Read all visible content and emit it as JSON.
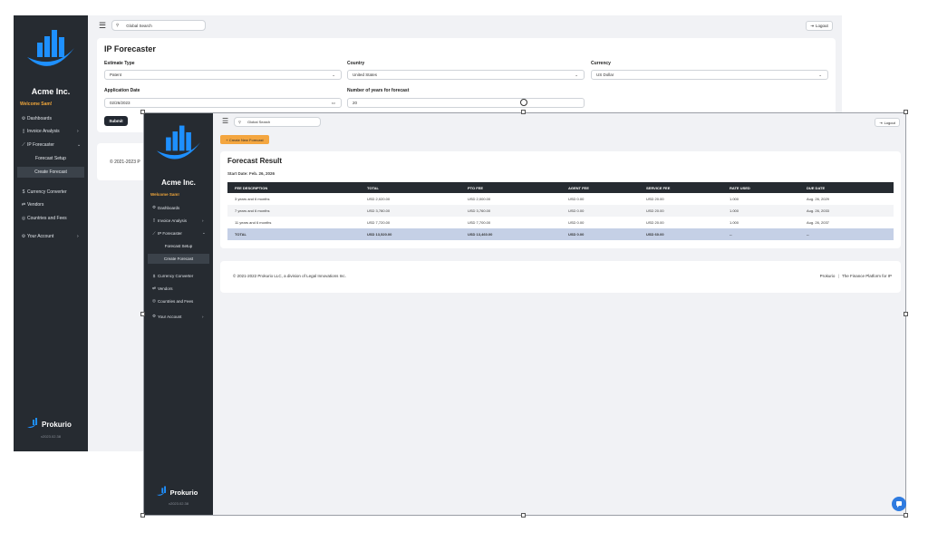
{
  "colors": {
    "sidebar": "#262b31",
    "accent_orange": "#f4a640",
    "welcome": "#f0a63a",
    "total_row": "#c5d0e6",
    "chat": "#2e7be0"
  },
  "back": {
    "search_placeholder": "Global Search",
    "logout_label": "Logout",
    "sidebar": {
      "company": "Acme Inc.",
      "welcome": "Welcome Sam!",
      "items": {
        "dashboards": "Dashboards",
        "invoice": "Invoice Analysis",
        "forecaster": "IP Forecaster",
        "forecast_setup": "Forecast Setup",
        "create_forecast": "Create Forecast",
        "currency": "Currency Converter",
        "vendors": "Vendors",
        "countries": "Countries and Fees",
        "account": "Your Account"
      },
      "footer_brand": "Prokurio",
      "version": "v2023.02.38"
    },
    "form": {
      "title": "IP Forecaster",
      "estimate_type_label": "Estimate Type",
      "estimate_type_value": "Patent",
      "country_label": "Country",
      "country_value": "United States",
      "currency_label": "Currency",
      "currency_value": "US Dollar",
      "application_date_label": "Application Date",
      "application_date_value": "02/26/2023",
      "years_label": "Number of years for forecast",
      "years_value": "20",
      "submit_label": "Submit"
    },
    "footer_partial": "© 2021-2023 P"
  },
  "front": {
    "search_placeholder": "Global Search",
    "logout_label": "Logout",
    "create_new_label": "+ Create New Forecast",
    "sidebar": {
      "company": "Acme Inc.",
      "welcome": "Welcome Sam!",
      "items": {
        "dashboards": "Dashboards",
        "invoice": "Invoice Analysis",
        "forecaster": "IP Forecaster",
        "forecast_setup": "Forecast Setup",
        "create_forecast": "Create Forecast",
        "currency": "Currency Converter",
        "vendors": "Vendors",
        "countries": "Countries and Fees",
        "account": "Your Account"
      },
      "footer_brand": "Prokurio",
      "version": "v2023.02.38"
    },
    "result": {
      "title": "Forecast Result",
      "start_date": "Start Date: Feb. 26, 2026",
      "headers": [
        "FEE DESCRIPTION",
        "TOTAL",
        "PTO FEE",
        "AGENT FEE",
        "SERVICE FEE",
        "RATE USED",
        "DUE DATE"
      ],
      "rows": [
        [
          "3 years and 6 months",
          "USD 2,020.00",
          "USD 2,000.00",
          "USD 0.00",
          "USD 20.00",
          "1.000",
          "Aug. 26, 2029"
        ],
        [
          "7 years and 6 months",
          "USD 3,780.00",
          "USD 3,760.00",
          "USD 0.00",
          "USD 20.00",
          "1.000",
          "Aug. 26, 2033"
        ],
        [
          "11 years and 6 months",
          "USD 7,720.00",
          "USD 7,700.00",
          "USD 0.00",
          "USD 20.00",
          "1.000",
          "Aug. 26, 2037"
        ]
      ],
      "total_row": [
        "TOTAL",
        "USD 13,520.00",
        "USD 13,460.00",
        "USD 0.00",
        "USD 60.00",
        "--",
        "--"
      ]
    },
    "footer": {
      "copyright": "© 2021-2022 Prokurio LLC, a division of Legal Innovations Inc.",
      "brand": "Prokurio",
      "tagline": "The Finance Platform for IP"
    }
  }
}
